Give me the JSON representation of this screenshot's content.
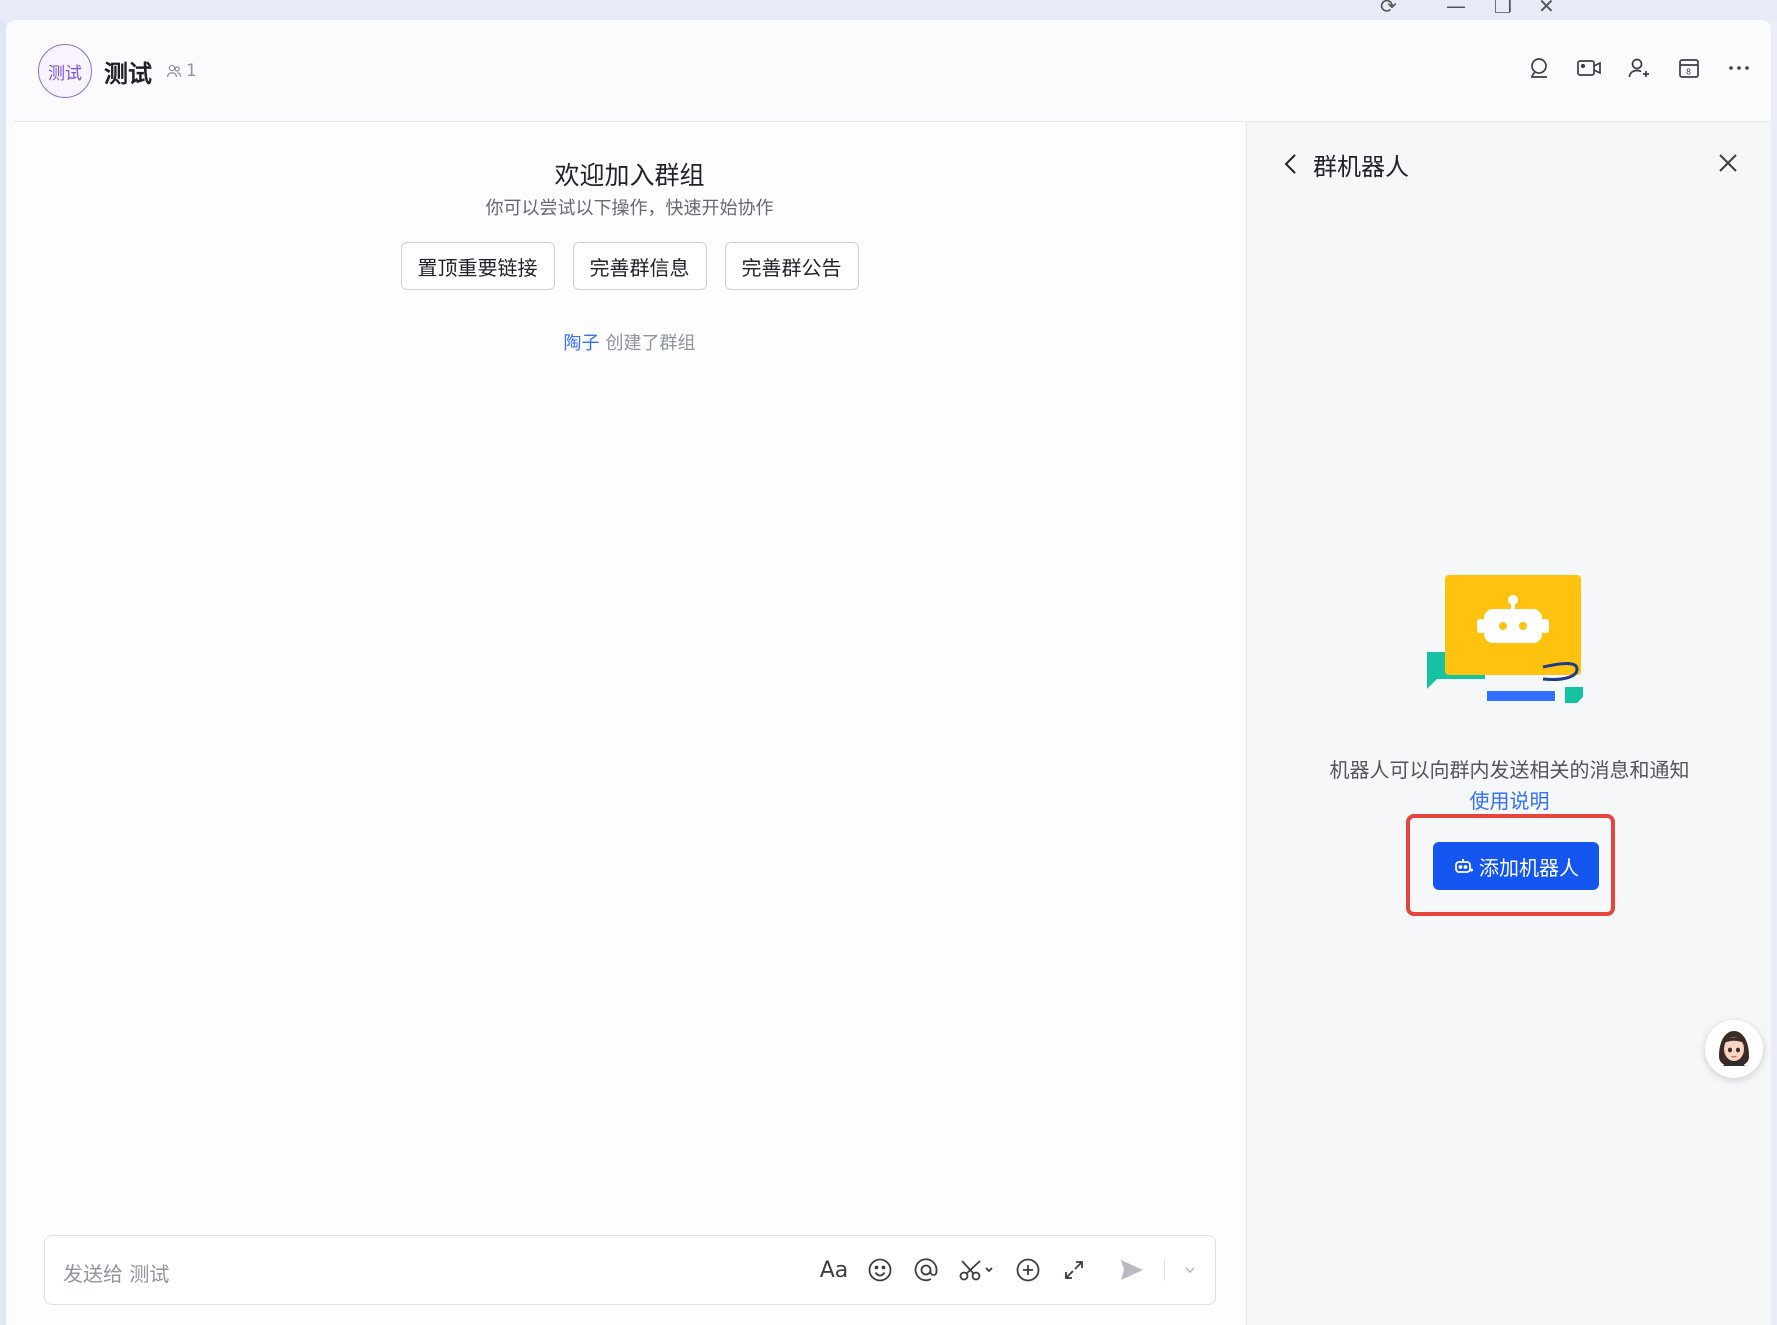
{
  "header": {
    "avatar_text": "测试",
    "group_name": "测试",
    "member_count": "1",
    "tools": [
      "search-icon",
      "video-icon",
      "add-member-icon",
      "calendar-icon",
      "more-icon"
    ]
  },
  "chat": {
    "welcome_title": "欢迎加入群组",
    "welcome_subtitle": "你可以尝试以下操作，快速开始协作",
    "quick_actions": [
      "置顶重要链接",
      "完善群信息",
      "完善群公告"
    ],
    "creator": "陶子",
    "created_text": "创建了群组"
  },
  "composer": {
    "placeholder": "发送给 测试",
    "format_label": "Aa"
  },
  "panel": {
    "title": "群机器人",
    "description": "机器人可以向群内发送相关的消息和通知",
    "help_link": "使用说明",
    "add_button": "添加机器人"
  },
  "colors": {
    "accent": "#1656f0",
    "link": "#3370ff",
    "highlight": "#e8443e",
    "avatar_purple": "#7b54d6"
  }
}
